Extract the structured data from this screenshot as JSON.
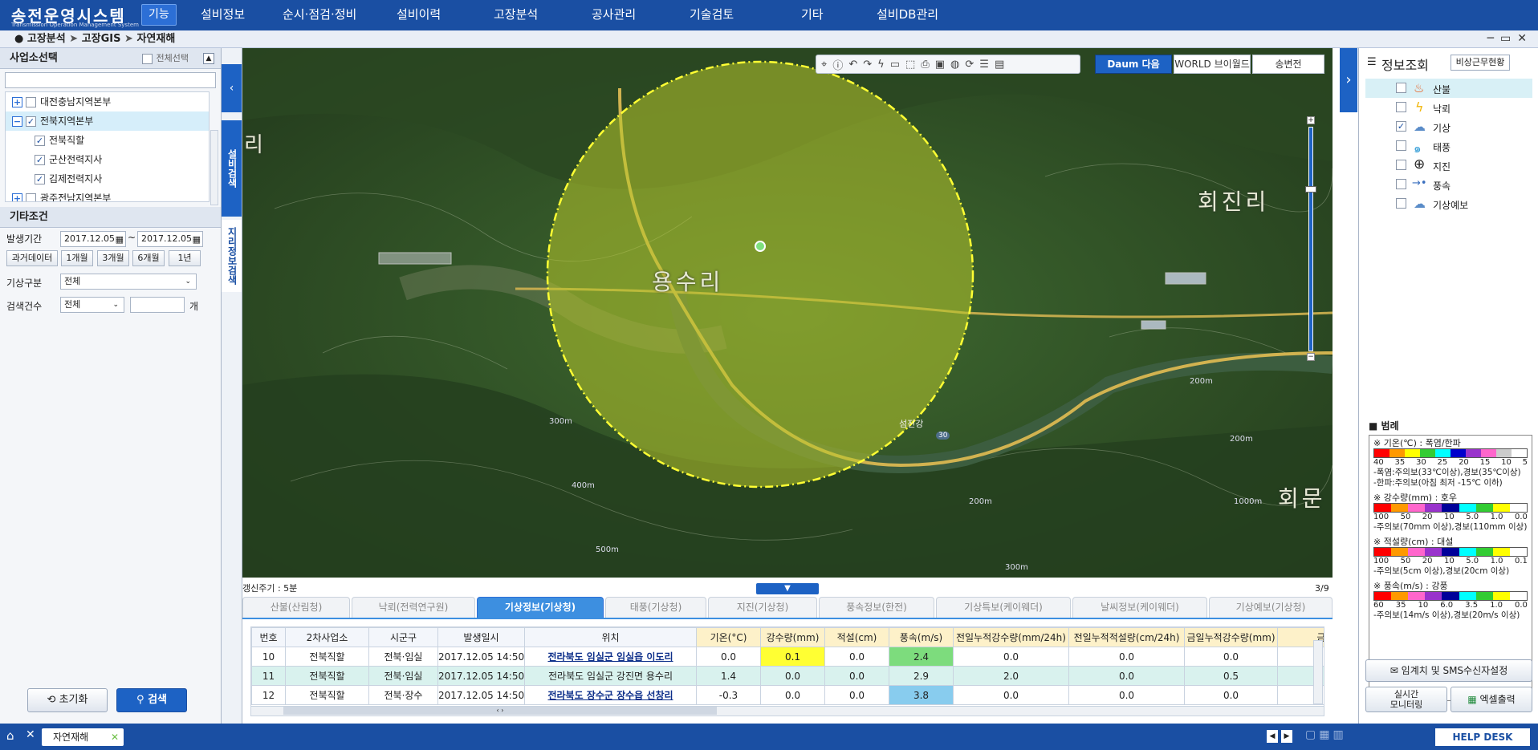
{
  "app": {
    "title": "송전운영시스템",
    "subtitle": "Transmission Operation Management System"
  },
  "menu": [
    "기능",
    "설비정보",
    "순시·점검·정비",
    "설비이력",
    "고장분석",
    "공사관리",
    "기술검토",
    "기타",
    "설비DB관리"
  ],
  "breadcrumb": [
    "고장분석",
    "고장GIS",
    "자연재해"
  ],
  "window_buttons": [
    "─",
    "▭",
    "✕"
  ],
  "left": {
    "office_title": "사업소선택",
    "select_all": "전체선택",
    "tree": [
      {
        "label": "대전충남지역본부",
        "expanded": false,
        "checked": false,
        "level": 0
      },
      {
        "label": "전북지역본부",
        "expanded": true,
        "checked": true,
        "level": 0
      },
      {
        "label": "전북직할",
        "checked": true,
        "level": 1
      },
      {
        "label": "군산전력지사",
        "checked": true,
        "level": 1
      },
      {
        "label": "김제전력지사",
        "checked": true,
        "level": 1
      },
      {
        "label": "광주전남지역본부",
        "expanded": false,
        "checked": false,
        "level": 0
      }
    ],
    "conditions_title": "기타조건",
    "period_label": "발생기간",
    "date_from": "2017.12.05",
    "date_to": "2017.12.05",
    "tilde": "~",
    "quick_buttons": [
      "과거데이터",
      "1개월",
      "3개월",
      "6개월",
      "1년"
    ],
    "weather_type_label": "기상구분",
    "weather_type_value": "전체",
    "count_label": "검색건수",
    "count_value": "전체",
    "count_unit": "개",
    "reset_button": "초기화",
    "search_button": "검색"
  },
  "side_tabs": [
    "설비검색",
    "지리정보검색"
  ],
  "map": {
    "toolbar_icons": [
      "marker-icon",
      "info-icon",
      "undo-icon",
      "redo-icon",
      "lightning-icon",
      "ruler-icon",
      "select-area-icon",
      "print-icon",
      "save-icon",
      "globe-icon",
      "refresh-icon",
      "list-icon",
      "layers-icon"
    ],
    "map_sources": [
      "Daum 다음",
      "WORLD 브이월드",
      "송변전"
    ],
    "labels": [
      "용수리",
      "회진리",
      "회문",
      "리",
      "섬진강",
      "30",
      "200m",
      "300m",
      "400m",
      "500m",
      "200m",
      "300m",
      "200m",
      "1000m"
    ],
    "refresh_cycle": "갱신주기 : 5분",
    "page_indicator": "3/9"
  },
  "tabs": [
    "산불(산림청)",
    "낙뢰(전력연구원)",
    "기상정보(기상청)",
    "태풍(기상청)",
    "지진(기상청)",
    "풍속정보(한전)",
    "기상특보(케이웨더)",
    "날씨정보(케이웨더)",
    "기상예보(기상청)"
  ],
  "active_tab": 2,
  "table": {
    "columns": [
      "번호",
      "2차사업소",
      "시군구",
      "발생일시",
      "위치",
      "기온(°C)",
      "강수량(mm)",
      "적설(cm)",
      "풍속(m/s)",
      "전일누적강수량(mm/24h)",
      "전일누적적설량(cm/24h)",
      "금일누적강수량(mm)",
      "금일누적"
    ],
    "rows": [
      [
        "10",
        "전북직할",
        "전북·임실",
        "2017.12.05 14:50",
        "전라북도 임실군 임실읍 이도리",
        "0.0",
        "0.1",
        "0.0",
        "2.4",
        "0.0",
        "0.0",
        "0.0",
        ""
      ],
      [
        "11",
        "전북직할",
        "전북·임실",
        "2017.12.05 14:50",
        "전라북도 임실군 강진면 용수리",
        "1.4",
        "0.0",
        "0.0",
        "2.9",
        "2.0",
        "0.0",
        "0.5",
        ""
      ],
      [
        "12",
        "전북직할",
        "전북·장수",
        "2017.12.05 14:50",
        "전라북도 장수군 장수읍 선창리",
        "-0.3",
        "0.0",
        "0.0",
        "3.8",
        "0.0",
        "0.0",
        "0.0",
        ""
      ]
    ]
  },
  "right": {
    "title": "정보조회",
    "emergency_button": "비상근무현황",
    "layers": [
      {
        "label": "산불",
        "checked": false,
        "icon": "fire-icon"
      },
      {
        "label": "낙뢰",
        "checked": false,
        "icon": "lightning-icon"
      },
      {
        "label": "기상",
        "checked": true,
        "icon": "cloud-icon"
      },
      {
        "label": "태풍",
        "checked": false,
        "icon": "typhoon-icon"
      },
      {
        "label": "지진",
        "checked": false,
        "icon": "earthquake-icon"
      },
      {
        "label": "풍속",
        "checked": false,
        "icon": "wind-icon"
      },
      {
        "label": "기상예보",
        "checked": false,
        "icon": "forecast-icon"
      }
    ],
    "legend_title": "범례",
    "legend": [
      {
        "title": "※ 기온(℃) : 폭염/한파",
        "colors": [
          "#ff0000",
          "#ff9900",
          "#ffff00",
          "#33cc33",
          "#00ffff",
          "#0000cc",
          "#9933cc",
          "#ff66cc",
          "#cccccc",
          "#ffffff"
        ],
        "nums": [
          "40",
          "35",
          "30",
          "25",
          "20",
          "15",
          "10",
          "5"
        ],
        "notes": [
          "-폭염:주의보(33℃이상),경보(35℃이상)",
          "-한파:주의보(아침 최저 -15℃ 이하)"
        ]
      },
      {
        "title": "※ 강수량(mm) : 호우",
        "colors": [
          "#ff0000",
          "#ff9900",
          "#ff66cc",
          "#9933cc",
          "#000099",
          "#00ffff",
          "#33cc33",
          "#ffff00",
          "#ffffff"
        ],
        "nums": [
          "100",
          "50",
          "20",
          "10",
          "5.0",
          "1.0",
          "0.0"
        ],
        "notes": [
          "-주의보(70mm 이상),경보(110mm 이상)"
        ]
      },
      {
        "title": "※ 적설량(cm) : 대설",
        "colors": [
          "#ff0000",
          "#ff9900",
          "#ff66cc",
          "#9933cc",
          "#000099",
          "#00ffff",
          "#33cc33",
          "#ffff00",
          "#ffffff"
        ],
        "nums": [
          "100",
          "50",
          "20",
          "10",
          "5.0",
          "1.0",
          "0.1"
        ],
        "notes": [
          "-주의보(5cm 이상),경보(20cm 이상)"
        ]
      },
      {
        "title": "※ 풍속(m/s) : 강풍",
        "colors": [
          "#ff0000",
          "#ff9900",
          "#ff66cc",
          "#9933cc",
          "#000099",
          "#00ffff",
          "#33cc33",
          "#ffff00",
          "#ffffff"
        ],
        "nums": [
          "60",
          "35",
          "10",
          "6.0",
          "3.5",
          "1.0",
          "0.0"
        ],
        "notes": [
          "-주의보(14m/s 이상),경보(20m/s 이상)"
        ]
      }
    ],
    "sms_button": "임계치 및 SMS수신자설정",
    "realtime_button": "실시간\n모니터링",
    "excel_button": "엑셀출력"
  },
  "footer": {
    "tab_label": "자연재해",
    "help": "HELP DESK"
  }
}
